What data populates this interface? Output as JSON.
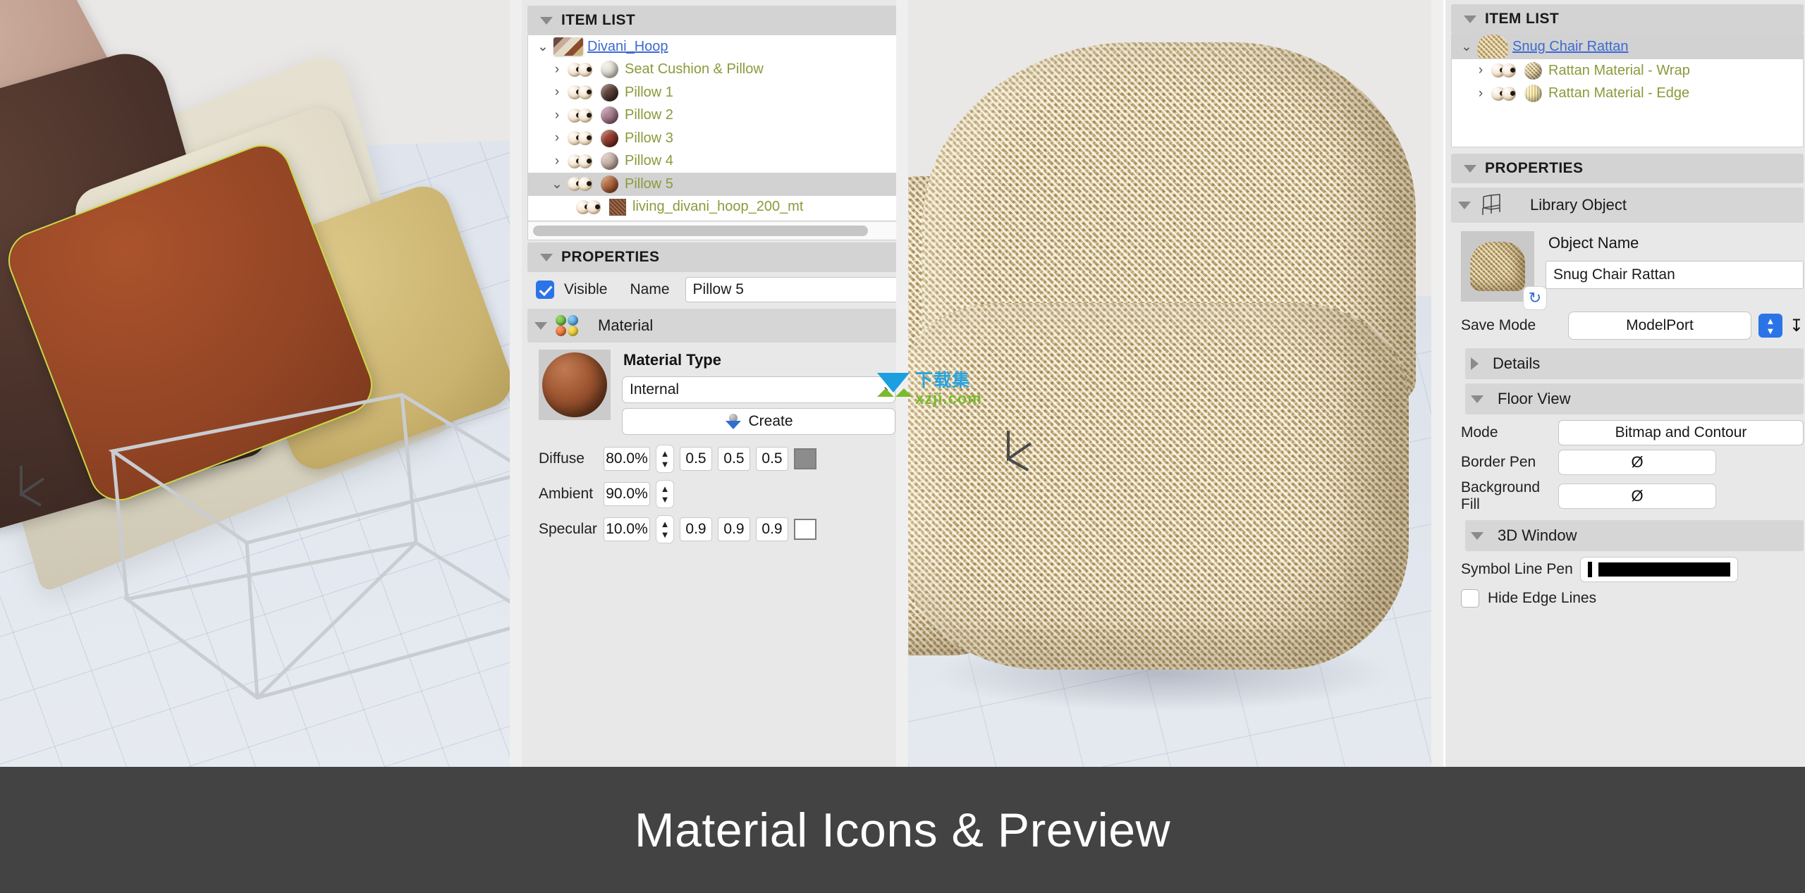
{
  "left_viewport": {
    "name": "sofa-3d-preview",
    "axis_marker": "view-axis-marker"
  },
  "middle_viewport": {
    "name": "rattan-chair-3d-preview",
    "axis_marker": "view-axis-marker"
  },
  "left_panel": {
    "item_list": {
      "header": "ITEM LIST",
      "rows": [
        {
          "label": "Divani_Hoop",
          "type": "root",
          "expander": "expanded",
          "icon": "sofa-thumbnail-icon"
        },
        {
          "label": "Seat Cushion & Pillow",
          "type": "child",
          "expander": "collapsed",
          "icon": "material-sphere-icon",
          "color": "#d8d6cb"
        },
        {
          "label": "Pillow 1",
          "type": "child",
          "expander": "collapsed",
          "icon": "material-sphere-icon",
          "color": "#4a332c"
        },
        {
          "label": "Pillow 2",
          "type": "child",
          "expander": "collapsed",
          "icon": "material-sphere-icon",
          "color": "#9a6f80"
        },
        {
          "label": "Pillow 3",
          "type": "child",
          "expander": "collapsed",
          "icon": "material-sphere-icon",
          "color": "#7e2f23"
        },
        {
          "label": "Pillow 4",
          "type": "child",
          "expander": "collapsed",
          "icon": "material-sphere-icon",
          "color": "#bda79c"
        },
        {
          "label": "Pillow 5",
          "type": "child",
          "expander": "expanded",
          "selected": true,
          "icon": "material-sphere-icon",
          "color": "#a05730"
        },
        {
          "label": "living_divani_hoop_200_mt",
          "type": "grandchild",
          "expander": "none",
          "icon": "texture-swatch-icon",
          "color": "#8a4e2c"
        }
      ],
      "scrollbar": "horizontal-scrollbar"
    },
    "properties": {
      "header": "PROPERTIES",
      "visible_label": "Visible",
      "visible_checked": true,
      "name_label": "Name",
      "name_value": "Pillow 5",
      "material_section": "Material",
      "material_type_label": "Material Type",
      "material_type_value": "Internal",
      "create_button": "Create",
      "rows": [
        {
          "label": "Diffuse",
          "percent": "80.0%",
          "r": "0.5",
          "g": "0.5",
          "b": "0.5",
          "swatch": "#8c8c8c",
          "has_rgb": true
        },
        {
          "label": "Ambient",
          "percent": "90.0%",
          "r": "",
          "g": "",
          "b": "",
          "swatch": "",
          "has_rgb": false
        },
        {
          "label": "Specular",
          "percent": "10.0%",
          "r": "0.9",
          "g": "0.9",
          "b": "0.9",
          "swatch": "#ffffff",
          "has_rgb": true
        }
      ]
    }
  },
  "right_panel": {
    "item_list": {
      "header": "ITEM LIST",
      "rows": [
        {
          "label": "Snug Chair Rattan",
          "type": "root",
          "expander": "expanded",
          "selected": true,
          "icon": "chair-thumbnail-icon"
        },
        {
          "label": "Rattan Material - Wrap",
          "type": "child",
          "expander": "collapsed",
          "icon": "material-sphere-icon",
          "color": "#cdb179"
        },
        {
          "label": "Rattan Material - Edge",
          "type": "child",
          "expander": "collapsed",
          "icon": "material-sphere-icon",
          "color": "#e0c77f"
        }
      ]
    },
    "properties": {
      "header": "PROPERTIES",
      "library_object_label": "Library Object",
      "object_name_label": "Object Name",
      "object_name_value": "Snug Chair Rattan",
      "save_mode_label": "Save Mode",
      "save_mode_value": "ModelPort",
      "details_label": "Details",
      "floor_view_label": "Floor View",
      "mode_label": "Mode",
      "mode_value": "Bitmap and Contour",
      "border_pen_label": "Border Pen",
      "border_pen_value": "Ø",
      "background_fill_label": "Background Fill",
      "background_fill_value": "Ø",
      "window_3d_label": "3D Window",
      "symbol_line_pen_label": "Symbol Line Pen",
      "hide_edge_lines_label": "Hide Edge Lines",
      "hide_edge_lines_checked": false
    }
  },
  "watermark": {
    "cn_text": "下载集",
    "en_text": "xzji.com"
  },
  "caption": {
    "title": "Material Icons & Preview"
  },
  "colors": {
    "accent_blue": "#2a74e8",
    "link_blue": "#3c6ad1",
    "tree_green": "#8a9a3b",
    "panel_bg": "#e8e8e8",
    "header_bg": "#d3d3d3",
    "caption_bg": "#434343"
  }
}
